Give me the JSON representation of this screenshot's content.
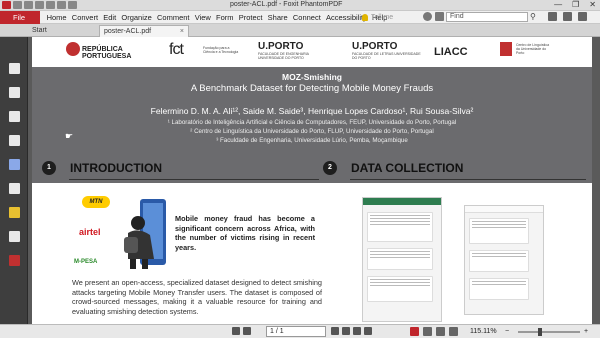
{
  "window": {
    "title": "poster-ACL.pdf - Foxit PhantomPDF",
    "controls": [
      "—",
      "❐",
      "✕"
    ]
  },
  "menu": {
    "file": "File",
    "items": [
      "Home",
      "Convert",
      "Edit",
      "Organize",
      "Comment",
      "View",
      "Form",
      "Protect",
      "Share",
      "Connect",
      "Accessibility",
      "Help"
    ],
    "tell_me": "Tell me",
    "find_placeholder": "Find"
  },
  "tabs": [
    {
      "label": "Start"
    },
    {
      "label": "poster-ACL.pdf",
      "close": "×"
    }
  ],
  "poster": {
    "logos": [
      {
        "name": "REPÚBLICA",
        "sub": "PORTUGUESA"
      },
      {
        "name": "fct",
        "sub": "Fundação para a Ciência e a Tecnologia"
      },
      {
        "name": "U.PORTO",
        "sub": "FACULDADE DE ENGENHARIA UNIVERSIDADE DO PORTO"
      },
      {
        "name": "U.PORTO",
        "sub": "FACULDADE DE LETRAS UNIVERSIDADE DO PORTO"
      },
      {
        "name": "LIACC",
        "sub": ""
      },
      {
        "name": "",
        "sub": "Centro de Linguística da Universidade do Porto"
      }
    ],
    "title": "MOZ-Smishing",
    "subtitle": "A Benchmark Dataset for Detecting Mobile Money Frauds",
    "authors": "Felermino D. M. A. Ali¹², Saide M. Saide³, Henrique Lopes Cardoso¹, Rui Sousa-Silva²",
    "affiliations": [
      "¹ Laboratório de Inteligência Artificial e Ciência de Computadores, FEUP, Universidade do Porto, Portugal",
      "² Centro de Linguística da Universidade do Porto, FLUP, Universidade do Porto, Portugal",
      "³ Faculdade de Engenharia, Universidade Lúrio, Pemba, Moçambique"
    ],
    "sections": [
      {
        "num": "1",
        "title": "INTRODUCTION"
      },
      {
        "num": "2",
        "title": "DATA COLLECTION"
      }
    ],
    "provider_logos": [
      "MTN",
      "airtel",
      "M-PESA"
    ],
    "intro_bold": "Mobile money fraud has become a significant concern across Africa, with the number of victims rising in recent years.",
    "intro_para": "We present an open-access, specialized dataset designed to detect smishing attacks targeting Mobile Money Transfer users. The dataset is composed of crowd-sourced messages, making it a valuable resource for training and evaluating smishing detection systems."
  },
  "status": {
    "page": "1 / 1",
    "zoom": "115.11%",
    "zoom_minus": "−",
    "zoom_plus": "+"
  },
  "colors": {
    "brand": "#c0262c",
    "banner": "#6b6b6e"
  }
}
